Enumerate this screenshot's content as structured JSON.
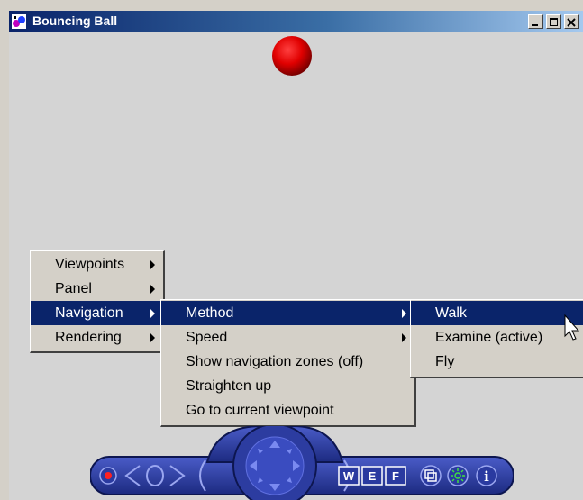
{
  "window": {
    "title": "Bouncing Ball"
  },
  "colors": {
    "ball": "#e00000",
    "menu_highlight": "#0a246a",
    "navbar": "#27389a"
  },
  "menu_main": [
    {
      "label": "Viewpoints"
    },
    {
      "label": "Panel"
    },
    {
      "label": "Navigation"
    },
    {
      "label": "Rendering"
    }
  ],
  "menu_navigation": [
    {
      "label": "Method"
    },
    {
      "label": "Speed"
    },
    {
      "label": "Show navigation zones (off)"
    },
    {
      "label": "Straighten up"
    },
    {
      "label": "Go to current viewpoint"
    }
  ],
  "menu_method": [
    {
      "label": "Walk"
    },
    {
      "label": "Examine (active)"
    },
    {
      "label": "Fly"
    }
  ],
  "navbar": {
    "mode_w": "W",
    "mode_e": "E",
    "mode_f": "F",
    "info": "i"
  }
}
